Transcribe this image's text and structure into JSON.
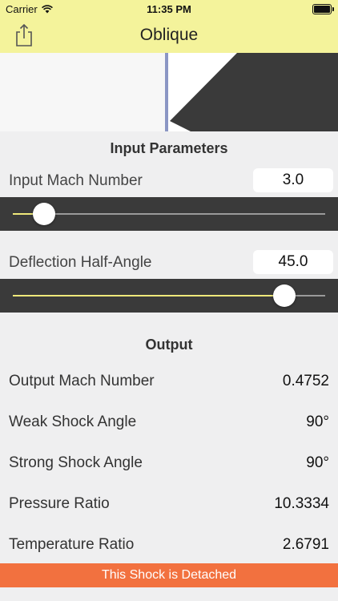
{
  "status_bar": {
    "carrier": "Carrier",
    "time": "11:35 PM"
  },
  "nav": {
    "title": "Oblique",
    "share_icon": "share-icon"
  },
  "input_section": {
    "header": "Input Parameters",
    "mach": {
      "label": "Input Mach Number",
      "value": "3.0",
      "slider_fraction": 0.1
    },
    "angle": {
      "label": "Deflection Half-Angle",
      "value": "45.0",
      "slider_fraction": 0.87
    }
  },
  "output_section": {
    "header": "Output",
    "rows": [
      {
        "label": "Output Mach Number",
        "value": "0.4752"
      },
      {
        "label": "Weak Shock Angle",
        "value": "90°"
      },
      {
        "label": "Strong Shock Angle",
        "value": "90°"
      },
      {
        "label": "Pressure Ratio",
        "value": "10.3334"
      },
      {
        "label": "Temperature Ratio",
        "value": "2.6791"
      }
    ]
  },
  "banner": {
    "text": "This Shock is Detached",
    "color": "#f2713f"
  },
  "colors": {
    "nav_bg": "#f4f39b",
    "slider_fill": "#efe87a",
    "slider_bg": "#3a3a3a",
    "shock_line": "#8b96c4"
  }
}
